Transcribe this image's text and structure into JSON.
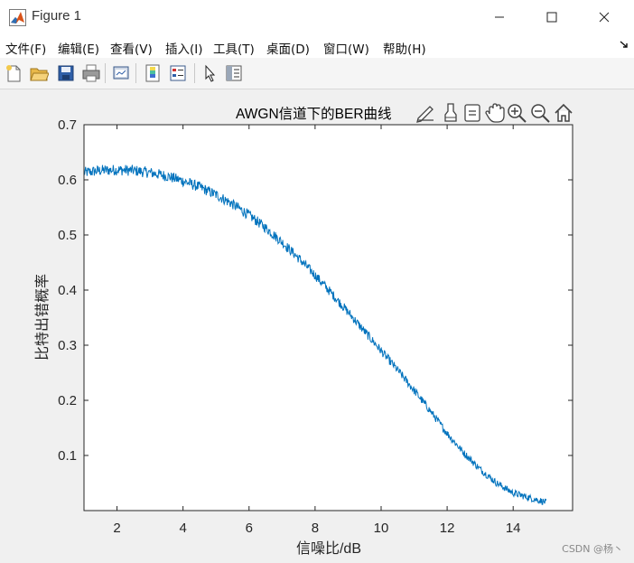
{
  "window": {
    "title": "Figure 1",
    "controls": [
      "minimize",
      "maximize",
      "close"
    ]
  },
  "menu": [
    "文件(F)",
    "编辑(E)",
    "查看(V)",
    "插入(I)",
    "工具(T)",
    "桌面(D)",
    "窗口(W)",
    "帮助(H)"
  ],
  "toolbar": [
    "new-figure-icon",
    "open-file-icon",
    "save-icon",
    "print-icon",
    "link-plot-icon",
    "insert-colorbar-icon",
    "insert-legend-icon",
    "select-pointer-icon",
    "property-inspector-icon"
  ],
  "axes_toolbar": [
    "export-icon",
    "brush-icon",
    "data-tips-icon",
    "pan-hand-icon",
    "zoom-in-icon",
    "zoom-out-icon",
    "home-icon"
  ],
  "watermark": "CSDN @杨丶",
  "chart_data": {
    "type": "line",
    "title": "AWGN信道下的BER曲线",
    "xlabel": "信噪比/dB",
    "ylabel": "比特出错概率",
    "xlim": [
      1,
      15.8
    ],
    "ylim": [
      0,
      0.7
    ],
    "xticks": [
      2,
      4,
      6,
      8,
      10,
      12,
      14
    ],
    "yticks": [
      0.1,
      0.2,
      0.3,
      0.4,
      0.5,
      0.6,
      0.7
    ],
    "line_color": "#0072bd",
    "grid": false,
    "series": [
      {
        "x": [
          1,
          1.5,
          2,
          2.5,
          3,
          3.5,
          4,
          4.5,
          5,
          5.5,
          6,
          6.5,
          7,
          7.5,
          8,
          8.5,
          9,
          9.5,
          10,
          10.5,
          11,
          11.5,
          12,
          12.5,
          13,
          13.5,
          14,
          14.5,
          15
        ],
        "values": [
          0.613,
          0.617,
          0.618,
          0.617,
          0.613,
          0.607,
          0.598,
          0.587,
          0.573,
          0.556,
          0.536,
          0.513,
          0.487,
          0.458,
          0.427,
          0.394,
          0.36,
          0.325,
          0.29,
          0.255,
          0.218,
          0.18,
          0.14,
          0.105,
          0.075,
          0.05,
          0.032,
          0.023,
          0.015
        ]
      }
    ]
  }
}
